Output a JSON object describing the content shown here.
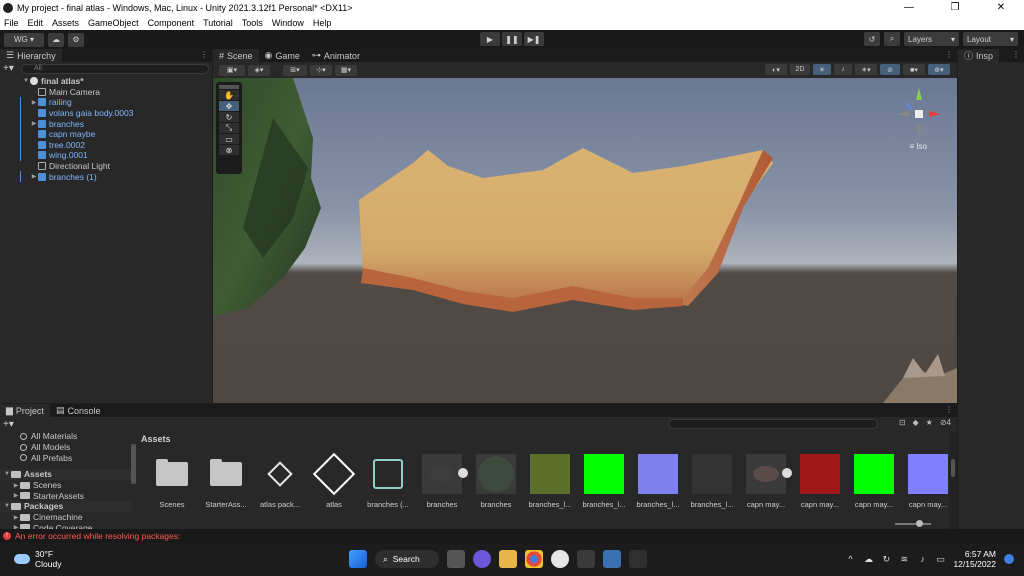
{
  "window": {
    "title": "My project - final atlas - Windows, Mac, Linux - Unity 2021.3.12f1 Personal* <DX11>",
    "minimize": "—",
    "maximize": "❐",
    "close": "✕"
  },
  "menu": [
    "File",
    "Edit",
    "Assets",
    "GameObject",
    "Component",
    "Tutorial",
    "Tools",
    "Window",
    "Help"
  ],
  "toolbar": {
    "account": "WG",
    "layers": "Layers",
    "layout": "Layout",
    "play": "▶",
    "pause": "❚❚",
    "step": "▶❚"
  },
  "hierarchy": {
    "tab": "Hierarchy",
    "search_placeholder": "All",
    "scene": "final atlas*",
    "items": [
      {
        "name": "Main Camera",
        "prefab": false,
        "expandable": false
      },
      {
        "name": "railing",
        "prefab": true,
        "expandable": true
      },
      {
        "name": "volans gaia body.0003",
        "prefab": true,
        "expandable": false
      },
      {
        "name": "branches",
        "prefab": true,
        "expandable": true
      },
      {
        "name": "capn maybe",
        "prefab": true,
        "expandable": false
      },
      {
        "name": "tree.0002",
        "prefab": true,
        "expandable": false
      },
      {
        "name": "wing.0001",
        "prefab": true,
        "expandable": false
      },
      {
        "name": "Directional Light",
        "prefab": false,
        "expandable": false
      },
      {
        "name": "branches (1)",
        "prefab": true,
        "expandable": true
      }
    ]
  },
  "scene_tabs": [
    "Scene",
    "Game",
    "Animator"
  ],
  "scene_toolbar": {
    "mode_2d": "2D"
  },
  "gizmo": {
    "projection": "Iso"
  },
  "inspector": {
    "tab": "Insp"
  },
  "project": {
    "tabs": [
      "Project",
      "Console"
    ],
    "favorites": [
      "All Materials",
      "All Models",
      "All Prefabs"
    ],
    "tree": [
      {
        "label": "Assets",
        "section": true
      },
      {
        "label": "Scenes",
        "section": false
      },
      {
        "label": "StarterAssets",
        "section": false
      },
      {
        "label": "Packages",
        "section": true
      },
      {
        "label": "Cinemachine",
        "section": false
      },
      {
        "label": "Code Coverage",
        "section": false
      }
    ],
    "breadcrumb": "Assets",
    "hidden_count": "4",
    "assets": [
      {
        "label": "Scenes",
        "kind": "folder",
        "color": "#c6c6c6"
      },
      {
        "label": "StarterAss...",
        "kind": "folder",
        "color": "#c6c6c6"
      },
      {
        "label": "atlas pack...",
        "kind": "unity",
        "color": "#e6e6e6"
      },
      {
        "label": "atlas",
        "kind": "unity-big",
        "color": "#ffffff"
      },
      {
        "label": "branches (...",
        "kind": "prefab-variant",
        "color": "#8fd0c8"
      },
      {
        "label": "branches",
        "kind": "model",
        "color": "#3d3d3d"
      },
      {
        "label": "branches",
        "kind": "sphere",
        "color": "#3f4a3f"
      },
      {
        "label": "branches_l...",
        "kind": "texture",
        "color": "#5b6e2a"
      },
      {
        "label": "branches_l...",
        "kind": "swatch",
        "color": "#00ff00"
      },
      {
        "label": "branches_l...",
        "kind": "swatch",
        "color": "#7f7ff0"
      },
      {
        "label": "branches_l...",
        "kind": "swatch",
        "color": "#333333"
      },
      {
        "label": "capn may...",
        "kind": "model",
        "color": "#5a4a4a"
      },
      {
        "label": "capn may...",
        "kind": "texture",
        "color": "#a01818"
      },
      {
        "label": "capn may...",
        "kind": "swatch",
        "color": "#00ff00"
      },
      {
        "label": "capn may...",
        "kind": "swatch",
        "color": "#7f7fff"
      }
    ]
  },
  "status": {
    "error": "An error occurred while resolving packages:"
  },
  "taskbar": {
    "temperature": "30°F",
    "condition": "Cloudy",
    "search": "Search",
    "time": "6:57 AM",
    "date": "12/15/2022"
  }
}
